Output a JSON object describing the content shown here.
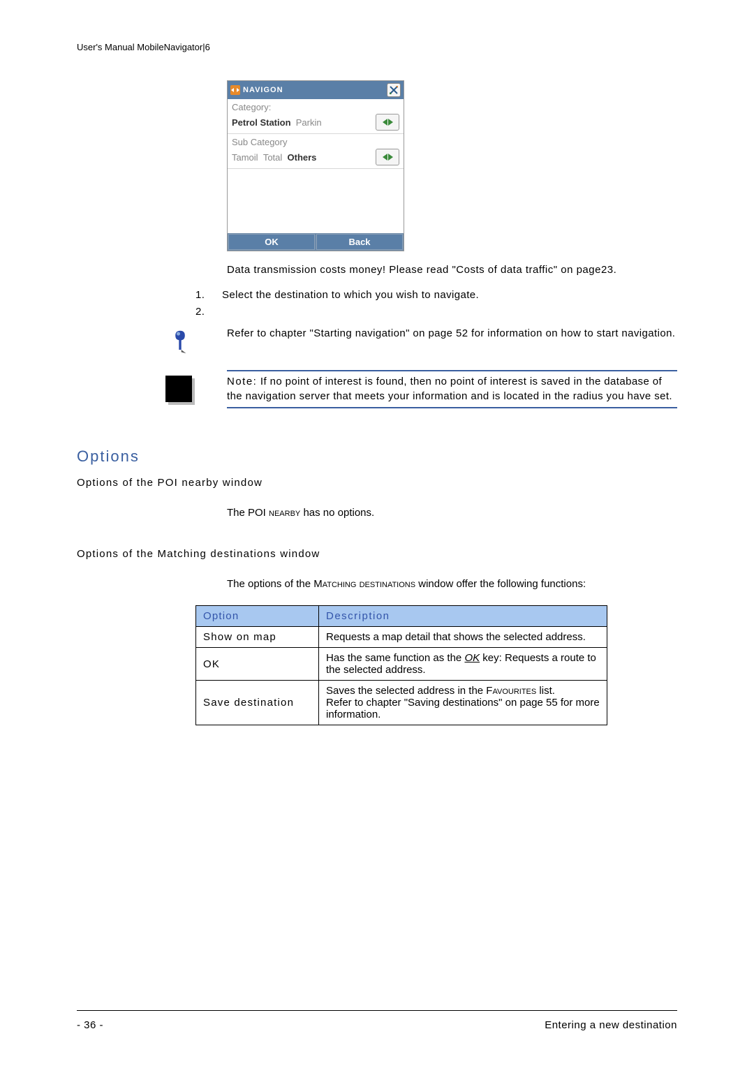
{
  "header": "User's Manual MobileNavigator|6",
  "device": {
    "title": "NAVIGON",
    "cat_label": "Category:",
    "cat_items": [
      "Petrol Station",
      "Parkin"
    ],
    "cat_selected_index": 0,
    "sub_label": "Sub Category",
    "sub_items": [
      "Tamoil",
      "Total",
      "Others"
    ],
    "sub_selected_index": 2,
    "ok": "OK",
    "back": "Back"
  },
  "para_cost": "Data transmission costs money! Please read \"Costs of data traffic\" on page23.",
  "step1": "Select the destination to which you wish to navigate.",
  "info_ref": "Refer to chapter \"Starting navigation\" on page 52 for information on how to start navigation.",
  "note_label": "Note:",
  "note_text": " If no point of interest is found, then no point of interest is saved in the database of the navigation server that meets your information and is located in the radius you have set.",
  "h_options": "Options",
  "h_poi": "Options of the POI nearby window",
  "poi_line_a": "The POI ",
  "poi_line_b": "nearby",
  "poi_line_c": " has no options.",
  "h_match": "Options of the Matching destinations window",
  "match_line_a": "The options of the M",
  "match_line_b": "atching destinations",
  "match_line_c": " window offer the following functions:",
  "table": {
    "h_option": "Option",
    "h_desc": "Description",
    "rows": [
      {
        "opt": "Show on map",
        "desc_a": "Requests a map detail that shows the selected address.",
        "desc_b": ""
      },
      {
        "opt": "OK",
        "desc_a": "Has the same function as the ",
        "desc_key": "OK",
        "desc_b": " key: Requests a route to the selected address."
      },
      {
        "opt": "Save destination",
        "desc_a": "Saves the selected address in the F",
        "desc_sc": "avourites",
        "desc_b": " list.",
        "desc_c": "Refer to chapter \"Saving destinations\" on page 55 for more information."
      }
    ]
  },
  "footer_left": "- 36 -",
  "footer_right": "Entering a new destination"
}
